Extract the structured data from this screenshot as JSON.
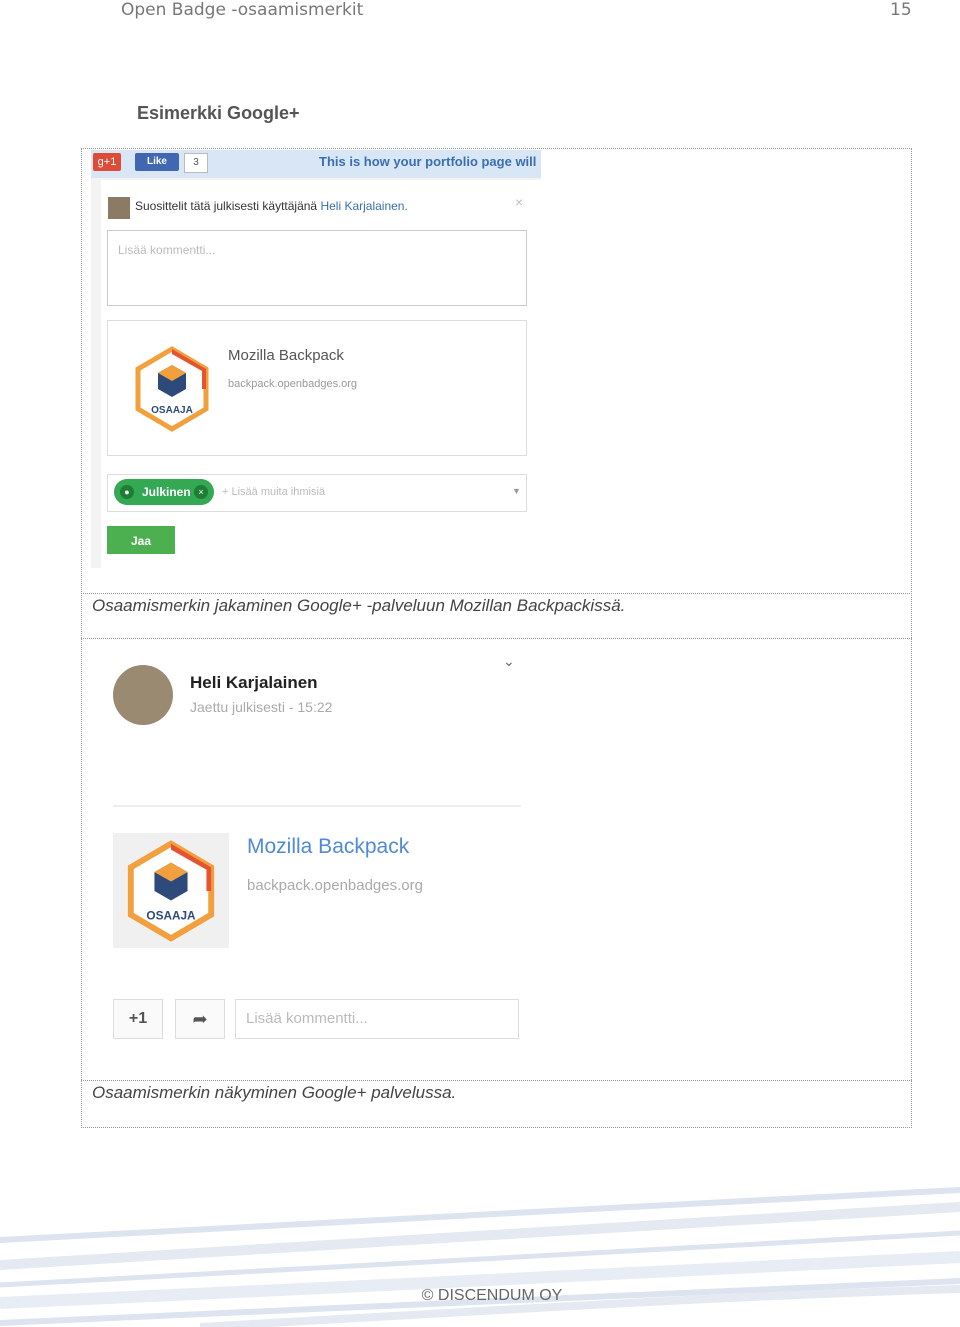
{
  "header": {
    "left": "Open Badge -osaamismerkit",
    "page_number": "15"
  },
  "section_title": "Esimerkki Google+",
  "figure1": {
    "toolbar": {
      "gplus_label": "g+1",
      "fb_like_label": "Like",
      "fb_count": "3",
      "portfolio_text": "This is how your portfolio page will"
    },
    "recommend_text": "Suosittelit tätä julkisesti käyttäjänä",
    "recommend_name": "Heli Karjalainen.",
    "close_symbol": "×",
    "comment_placeholder": "Lisää kommentti...",
    "link_title": "Mozilla Backpack",
    "link_url": "backpack.openbadges.org",
    "badge_text": "OSAAJA",
    "audience_pill": "Julkinen",
    "audience_placeholder": "+ Lisää muita ihmisiä",
    "share_button": "Jaa",
    "caption": "Osaamismerkin jakaminen Google+ -palveluun Mozillan Backpackissä."
  },
  "figure2": {
    "author": "Heli Karjalainen",
    "meta": "Jaettu julkisesti  -  15:22",
    "link_title": "Mozilla Backpack",
    "link_url": "backpack.openbadges.org",
    "badge_text": "OSAAJA",
    "plus_one": "+1",
    "comment_placeholder": "Lisää kommentti...",
    "caption": "Osaamismerkin näkyminen Google+ palvelussa."
  },
  "footer": "© DISCENDUM OY",
  "colors": {
    "gplus_red": "#dd4b39",
    "fb_blue": "#4267b2",
    "public_green": "#34a853",
    "link_blue": "#4f8bd4",
    "badge_orange": "#f2a03d"
  }
}
